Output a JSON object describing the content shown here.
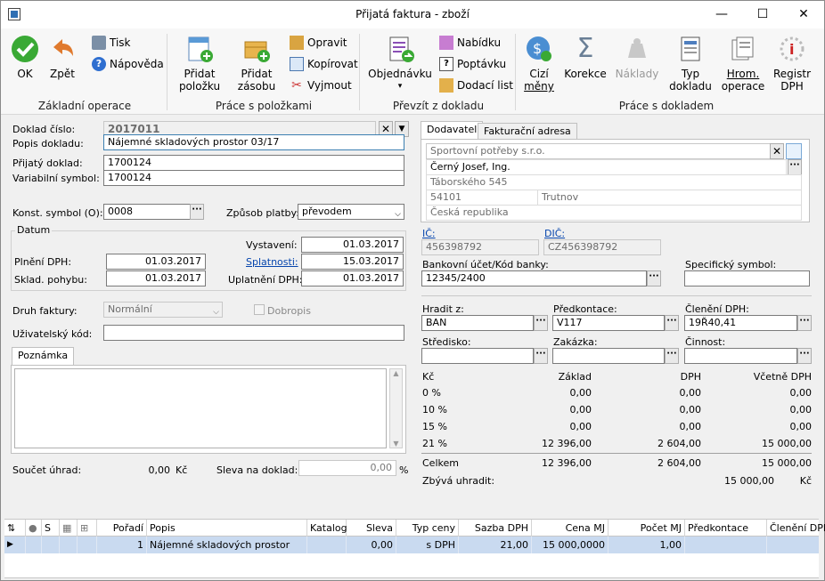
{
  "window": {
    "title": "Přijatá faktura - zboží",
    "min": "—",
    "max": "☐",
    "close": "✕"
  },
  "ribbon": {
    "ok": "OK",
    "back": "Zpět",
    "print": "Tisk",
    "help": "Nápověda",
    "grp_basic": "Základní operace",
    "add_item": "Přidat",
    "add_item2": "položku",
    "add_stock": "Přidat",
    "add_stock2": "zásobu",
    "edit": "Opravit",
    "copy": "Kopírovat",
    "cut": "Vyjmout",
    "grp_items": "Práce s položkami",
    "orders": "Objednávku",
    "offer": "Nabídku",
    "inquiry": "Poptávku",
    "delivery": "Dodací list",
    "grp_take": "Převzít z dokladu",
    "foreign": "Cizí",
    "foreign2": "měny",
    "corrections": "Korekce",
    "costs": "Náklady",
    "doctype": "Typ",
    "doctype2": "dokladu",
    "bulk": "Hrom.",
    "bulk2": "operace",
    "vat_report": "Registr",
    "vat_report2": "DPH",
    "grp_doc": "Práce s dokladem"
  },
  "doc": {
    "number_label": "Doklad číslo:",
    "number": "2017011",
    "desc_label": "Popis dokladu:",
    "desc": "Nájemné skladových prostor 03/17",
    "recv_label": "Přijatý doklad:",
    "recv": "1700124",
    "varsym_label": "Variabilní symbol:",
    "varsym": "1700124",
    "konst_label": "Konst. symbol (O):",
    "konst": "0008",
    "payment_label": "Způsob platby:",
    "payment": "převodem",
    "date_group": "Datum",
    "issued_label": "Vystavení:",
    "issued": "01.03.2017",
    "vatdate_label": "Plnění DPH:",
    "vatdate": "01.03.2017",
    "due_label": "Splatnosti:",
    "due": "15.03.2017",
    "stock_label": "Sklad. pohybu:",
    "stock": "01.03.2017",
    "vatapply_label": "Uplatnění DPH:",
    "vatapply": "01.03.2017",
    "kind_label": "Druh faktury:",
    "kind": "Normální",
    "dobropis": "Dobropis",
    "usercode_label": "Uživatelský kód:",
    "usercode": "",
    "note_tab": "Poznámka",
    "paysum_label": "Součet úhrad:",
    "paysum": "0,00",
    "paysum_cur": "Kč",
    "discount_label": "Sleva na doklad:",
    "discount": "0,00",
    "discount_unit": "%"
  },
  "supplier": {
    "tab1": "Dodavatel",
    "tab2": "Fakturační adresa",
    "company": "Sportovní potřeby s.r.o.",
    "person": "Černý Josef, Ing.",
    "street": "Táborského 545",
    "zip": "54101",
    "city": "Trutnov",
    "country": "Česká republika",
    "ico_label": "IČ:",
    "ico": "456398792",
    "dic_label": "DIČ:",
    "dic": "CZ456398792",
    "bank_label": "Bankovní účet/Kód banky:",
    "bank": "12345/2400",
    "specsym_label": "Specifický symbol:",
    "specsym": ""
  },
  "accounting": {
    "pay_from_label": "Hradit z:",
    "pay_from": "BAN",
    "precont_label": "Předkontace:",
    "precont": "V117",
    "vatclass_label": "Členění DPH:",
    "vatclass": "19Ř40,41",
    "center_label": "Středisko:",
    "center": "",
    "contract_label": "Zakázka:",
    "contract": "",
    "activity_label": "Činnost:",
    "activity": ""
  },
  "summary": {
    "headers": [
      "Kč",
      "Základ",
      "DPH",
      "Včetně DPH"
    ],
    "rows": [
      [
        "0 %",
        "0,00",
        "0,00",
        "0,00"
      ],
      [
        "10 %",
        "0,00",
        "0,00",
        "0,00"
      ],
      [
        "15 %",
        "0,00",
        "0,00",
        "0,00"
      ],
      [
        "21 %",
        "12 396,00",
        "2 604,00",
        "15 000,00"
      ]
    ],
    "total": [
      "Celkem",
      "12 396,00",
      "2 604,00",
      "15 000,00"
    ],
    "remaining_label": "Zbývá uhradit:",
    "remaining": "15 000,00",
    "remaining_cur": "Kč"
  },
  "grid": {
    "headers": {
      "s": "S",
      "order": "Pořadí",
      "desc": "Popis",
      "catalog": "Katalog",
      "discount": "Sleva",
      "price_type": "Typ ceny",
      "vat_rate": "Sazba DPH",
      "unit_price": "Cena MJ",
      "qty": "Počet MJ",
      "precont": "Předkontace",
      "vatclass": "Členění DPH"
    },
    "row": {
      "order": "1",
      "desc": "Nájemné skladových prostor",
      "catalog": "",
      "discount": "0,00",
      "price_type": "s DPH",
      "vat_rate": "21,00",
      "unit_price": "15 000,0000",
      "qty": "1,00",
      "precont": "",
      "vatclass": ""
    }
  }
}
